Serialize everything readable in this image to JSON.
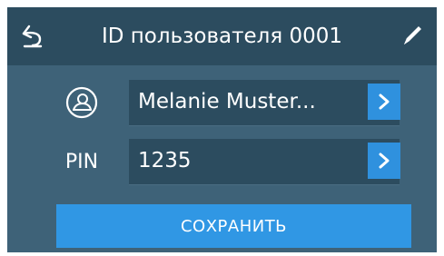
{
  "header": {
    "title": "ID пользователя 0001",
    "back_icon": "back-arrow-icon",
    "edit_icon": "pencil-icon"
  },
  "user_row": {
    "icon": "user-avatar-icon",
    "value": "Melanie Muster...",
    "arrow_icon": "chevron-right-icon"
  },
  "pin_row": {
    "label": "PIN",
    "value": "1235",
    "arrow_icon": "chevron-right-icon"
  },
  "save_label": "СОХРАНИТЬ",
  "colors": {
    "screen_background": "#3e6278",
    "header_background": "#2c4c5f",
    "field_background": "#2c4c5f",
    "accent_blue": "#2f91de",
    "text": "#ffffff"
  }
}
